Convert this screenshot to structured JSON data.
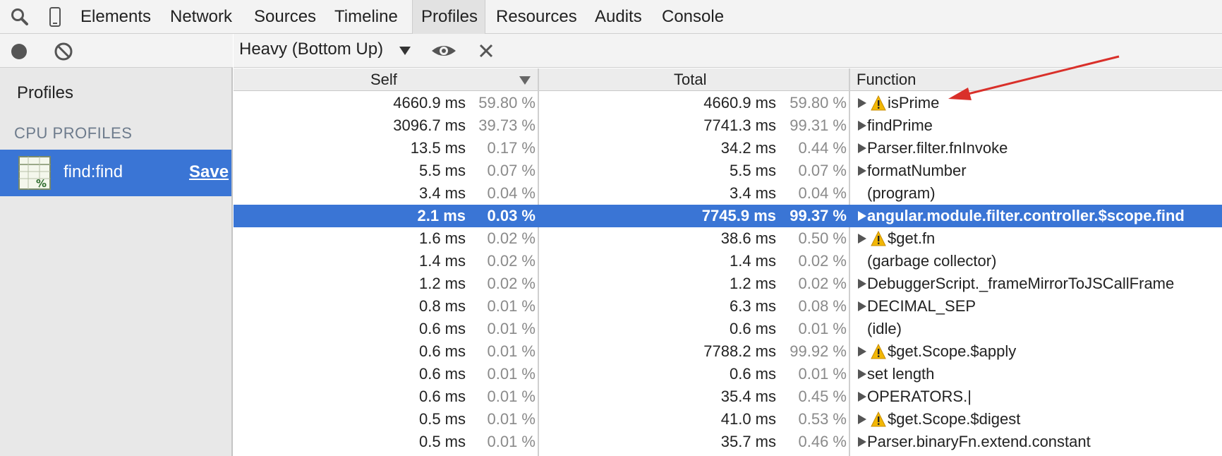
{
  "tabs": [
    {
      "label": "Elements",
      "active": false
    },
    {
      "label": "Network",
      "active": false
    },
    {
      "label": "Sources",
      "active": false
    },
    {
      "label": "Timeline",
      "active": false
    },
    {
      "label": "Profiles",
      "active": true
    },
    {
      "label": "Resources",
      "active": false
    },
    {
      "label": "Audits",
      "active": false
    },
    {
      "label": "Console",
      "active": false
    }
  ],
  "toolbar": {
    "view_mode": "Heavy (Bottom Up)"
  },
  "sidebar": {
    "title": "Profiles",
    "section": "CPU PROFILES",
    "profile": {
      "name": "find:find",
      "save_label": "Save"
    }
  },
  "columns": {
    "self": "Self",
    "total": "Total",
    "function": "Function"
  },
  "rows": [
    {
      "self": "4660.9 ms",
      "self_pct": "59.80 %",
      "total": "4660.9 ms",
      "total_pct": "59.80 %",
      "fn": "isPrime",
      "expand": true,
      "warning": true,
      "selected": false
    },
    {
      "self": "3096.7 ms",
      "self_pct": "39.73 %",
      "total": "7741.3 ms",
      "total_pct": "99.31 %",
      "fn": "findPrime",
      "expand": true,
      "warning": false,
      "selected": false
    },
    {
      "self": "13.5 ms",
      "self_pct": "0.17 %",
      "total": "34.2 ms",
      "total_pct": "0.44 %",
      "fn": "Parser.filter.fnInvoke",
      "expand": true,
      "warning": false,
      "selected": false
    },
    {
      "self": "5.5 ms",
      "self_pct": "0.07 %",
      "total": "5.5 ms",
      "total_pct": "0.07 %",
      "fn": "formatNumber",
      "expand": true,
      "warning": false,
      "selected": false
    },
    {
      "self": "3.4 ms",
      "self_pct": "0.04 %",
      "total": "3.4 ms",
      "total_pct": "0.04 %",
      "fn": "(program)",
      "expand": false,
      "warning": false,
      "selected": false
    },
    {
      "self": "2.1 ms",
      "self_pct": "0.03 %",
      "total": "7745.9 ms",
      "total_pct": "99.37 %",
      "fn": "angular.module.filter.controller.$scope.find",
      "expand": true,
      "warning": false,
      "selected": true
    },
    {
      "self": "1.6 ms",
      "self_pct": "0.02 %",
      "total": "38.6 ms",
      "total_pct": "0.50 %",
      "fn": "$get.fn",
      "expand": true,
      "warning": true,
      "selected": false
    },
    {
      "self": "1.4 ms",
      "self_pct": "0.02 %",
      "total": "1.4 ms",
      "total_pct": "0.02 %",
      "fn": "(garbage collector)",
      "expand": false,
      "warning": false,
      "selected": false
    },
    {
      "self": "1.2 ms",
      "self_pct": "0.02 %",
      "total": "1.2 ms",
      "total_pct": "0.02 %",
      "fn": "DebuggerScript._frameMirrorToJSCallFrame",
      "expand": true,
      "warning": false,
      "selected": false
    },
    {
      "self": "0.8 ms",
      "self_pct": "0.01 %",
      "total": "6.3 ms",
      "total_pct": "0.08 %",
      "fn": "DECIMAL_SEP",
      "expand": true,
      "warning": false,
      "selected": false
    },
    {
      "self": "0.6 ms",
      "self_pct": "0.01 %",
      "total": "0.6 ms",
      "total_pct": "0.01 %",
      "fn": "(idle)",
      "expand": false,
      "warning": false,
      "selected": false
    },
    {
      "self": "0.6 ms",
      "self_pct": "0.01 %",
      "total": "7788.2 ms",
      "total_pct": "99.92 %",
      "fn": "$get.Scope.$apply",
      "expand": true,
      "warning": true,
      "selected": false
    },
    {
      "self": "0.6 ms",
      "self_pct": "0.01 %",
      "total": "0.6 ms",
      "total_pct": "0.01 %",
      "fn": "set length",
      "expand": true,
      "warning": false,
      "selected": false
    },
    {
      "self": "0.6 ms",
      "self_pct": "0.01 %",
      "total": "35.4 ms",
      "total_pct": "0.45 %",
      "fn": "OPERATORS.|",
      "expand": true,
      "warning": false,
      "selected": false
    },
    {
      "self": "0.5 ms",
      "self_pct": "0.01 %",
      "total": "41.0 ms",
      "total_pct": "0.53 %",
      "fn": "$get.Scope.$digest",
      "expand": true,
      "warning": true,
      "selected": false
    },
    {
      "self": "0.5 ms",
      "self_pct": "0.01 %",
      "total": "35.7 ms",
      "total_pct": "0.46 %",
      "fn": "Parser.binaryFn.extend.constant",
      "expand": true,
      "warning": false,
      "selected": false
    }
  ],
  "icons": {
    "search": "search-icon",
    "device": "device-mode-icon",
    "record": "record-icon",
    "clear": "clear-icon",
    "dropdown": "dropdown-arrow-icon",
    "eye": "eye-icon",
    "close": "close-icon",
    "sort": "sort-descending-icon",
    "expand": "expand-triangle-icon",
    "warning": "warning-icon",
    "profile": "cpu-profile-icon",
    "annotation": "annotation-arrow"
  },
  "colors": {
    "selection": "#3a75d5",
    "warning": "#f2b705",
    "annotation": "#d9302a"
  }
}
